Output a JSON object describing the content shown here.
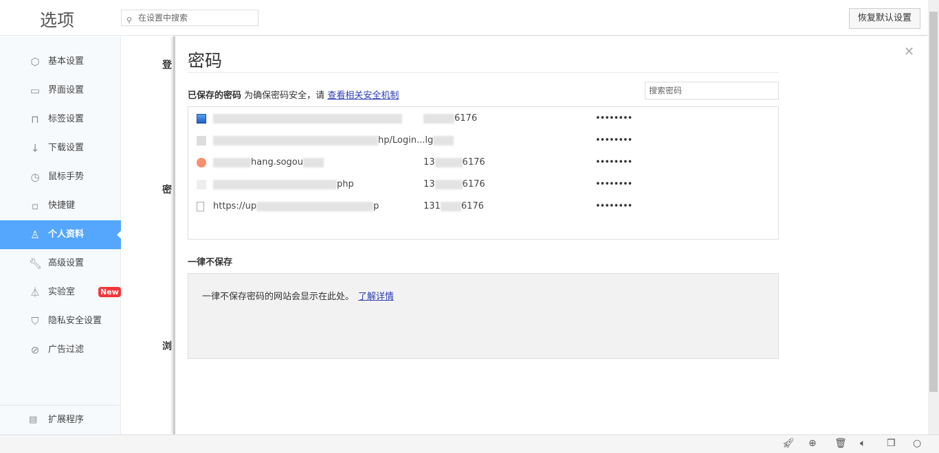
{
  "header": {
    "title": "选项",
    "search_placeholder": "在设置中搜索",
    "restore_label": "恢复默认设置"
  },
  "sidebar": {
    "items": [
      {
        "label": "基本设置",
        "icon": "hexagon-gear-icon"
      },
      {
        "label": "界面设置",
        "icon": "window-icon"
      },
      {
        "label": "标签设置",
        "icon": "tab-icon"
      },
      {
        "label": "下载设置",
        "icon": "download-icon"
      },
      {
        "label": "鼠标手势",
        "icon": "mouse-icon"
      },
      {
        "label": "快捷键",
        "icon": "keyboard-icon"
      },
      {
        "label": "个人资料",
        "icon": "user-icon",
        "active": true
      },
      {
        "label": "高级设置",
        "icon": "wrench-icon"
      },
      {
        "label": "实验室",
        "icon": "flask-icon",
        "badge": "New"
      },
      {
        "label": "隐私安全设置",
        "icon": "shield-icon"
      },
      {
        "label": "广告过滤",
        "icon": "block-icon"
      }
    ],
    "extensions": "扩展程序"
  },
  "background_headings": [
    "登",
    "密",
    "浏"
  ],
  "dialog": {
    "title": "密码",
    "saved_label": "已保存的密码",
    "saved_note": "为确保密码安全，请",
    "saved_link": "查看相关安全机制",
    "search_placeholder": "搜索密码",
    "rows": [
      {
        "site": "",
        "user": "6176",
        "password": "••••••••",
        "favicon": "chart-favicon-icon"
      },
      {
        "site": "hp/Login...lg",
        "user": "",
        "password": "••••••••",
        "favicon": "blank-favicon-icon"
      },
      {
        "site": "hang.sogou",
        "user": "13",
        "password": "••••••••",
        "favicon": "sogou-favicon-icon"
      },
      {
        "site": "php",
        "user": "13",
        "password": "••••••••",
        "favicon": "blank-favicon-icon"
      },
      {
        "site": "https://up",
        "user": "131",
        "password": "••••••••",
        "favicon": "page-icon"
      }
    ],
    "user_suffix": "6176",
    "never_title": "一律不保存",
    "never_text": "一律不保存密码的网站会显示在此处。",
    "never_link": "了解详情"
  },
  "statusbar": {
    "icons": [
      "rocket-icon",
      "speed-icon",
      "trash-icon",
      "volume-icon",
      "window-icon",
      "search-icon"
    ]
  }
}
